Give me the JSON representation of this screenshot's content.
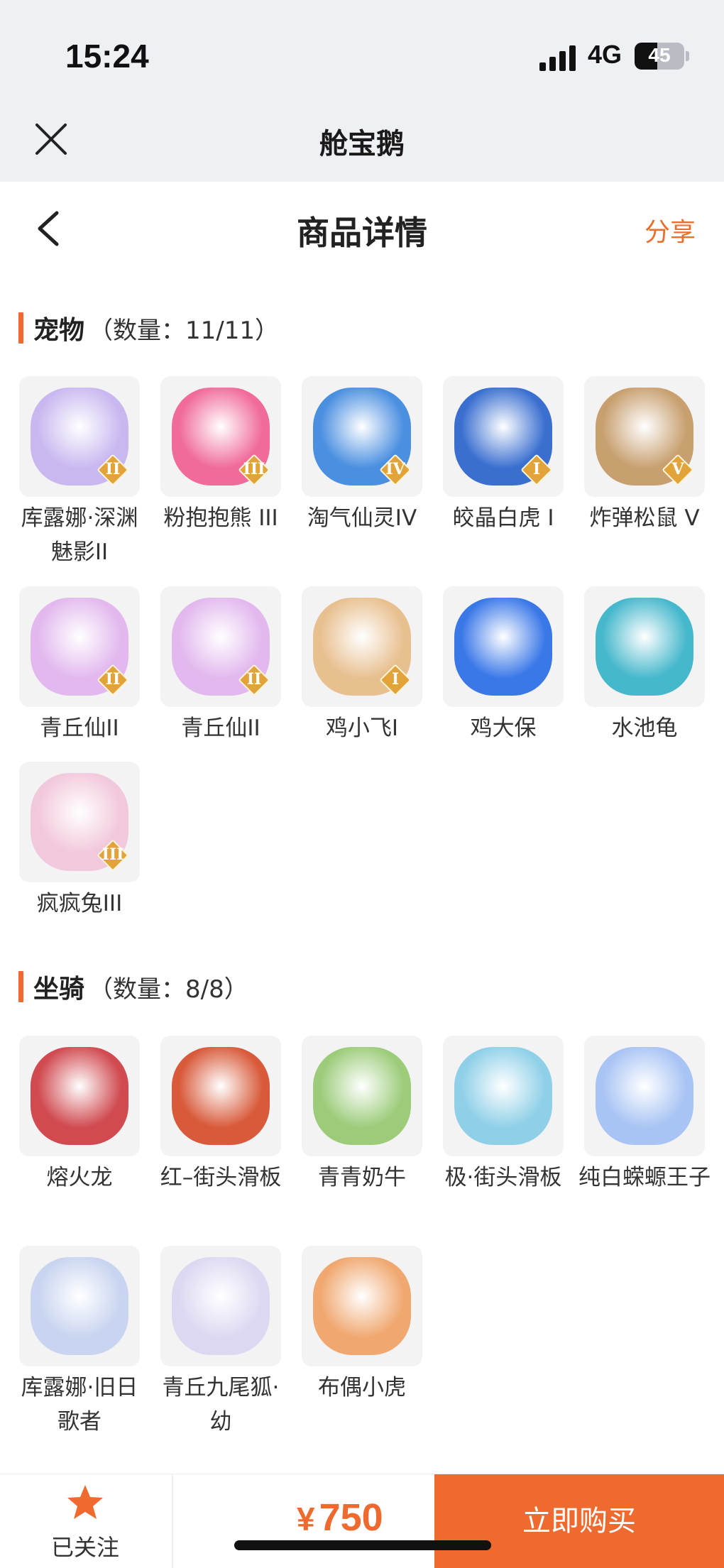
{
  "status": {
    "time": "15:24",
    "network": "4G",
    "battery": "45",
    "battery_level": 0.45
  },
  "app": {
    "title": "舱宝鹅"
  },
  "nav": {
    "title": "商品详情",
    "share": "分享"
  },
  "pets": {
    "title": "宠物",
    "count": "（数量：11/11）",
    "items": [
      {
        "name": "库露娜·深渊魅影II",
        "badge": "II",
        "color": "#c9b8f0"
      },
      {
        "name": "粉抱抱熊 III",
        "badge": "III",
        "color": "#f06a9a"
      },
      {
        "name": "淘气仙灵IV",
        "badge": "IV",
        "color": "#4a8fe0"
      },
      {
        "name": "皎晶白虎 I",
        "badge": "I",
        "color": "#3a6fd0"
      },
      {
        "name": "炸弹松鼠 V",
        "badge": "V",
        "color": "#c8a070"
      },
      {
        "name": "青丘仙II",
        "badge": "II",
        "color": "#e2b8ee"
      },
      {
        "name": "青丘仙II",
        "badge": "II",
        "color": "#e2b8ee"
      },
      {
        "name": "鸡小飞I",
        "badge": "I",
        "color": "#e8c090"
      },
      {
        "name": "鸡大保",
        "badge": "",
        "color": "#3a78e8"
      },
      {
        "name": "水池龟",
        "badge": "",
        "color": "#46b8cc"
      },
      {
        "name": "疯疯兔III",
        "badge": "III",
        "color": "#f2c8dc"
      }
    ]
  },
  "mounts": {
    "title": "坐骑",
    "count": "（数量：8/8）",
    "items": [
      {
        "name": "熔火龙",
        "badge": "",
        "color": "#d04a50"
      },
      {
        "name": "红–街头滑板",
        "badge": "",
        "color": "#d85a3a"
      },
      {
        "name": "青青奶牛",
        "badge": "",
        "color": "#9ccc7a"
      },
      {
        "name": "极·街头滑板",
        "badge": "",
        "color": "#8fd0e8"
      },
      {
        "name": "纯白蝾螈王子",
        "badge": "",
        "color": "#a8c4f4"
      },
      {
        "name": "库露娜·旧日歌者",
        "badge": "",
        "color": "#c8d4f0"
      },
      {
        "name": "青丘九尾狐·幼",
        "badge": "",
        "color": "#ddd8f2"
      },
      {
        "name": "布偶小虎",
        "badge": "",
        "color": "#f0a870"
      }
    ]
  },
  "footer": {
    "follow_label": "已关注",
    "currency": "¥",
    "price": "750",
    "buy_label": "立即购买"
  },
  "icons": {
    "close": "close-icon",
    "back": "chevron-left-icon",
    "star": "star-icon"
  },
  "accent": "#ee6a2f"
}
